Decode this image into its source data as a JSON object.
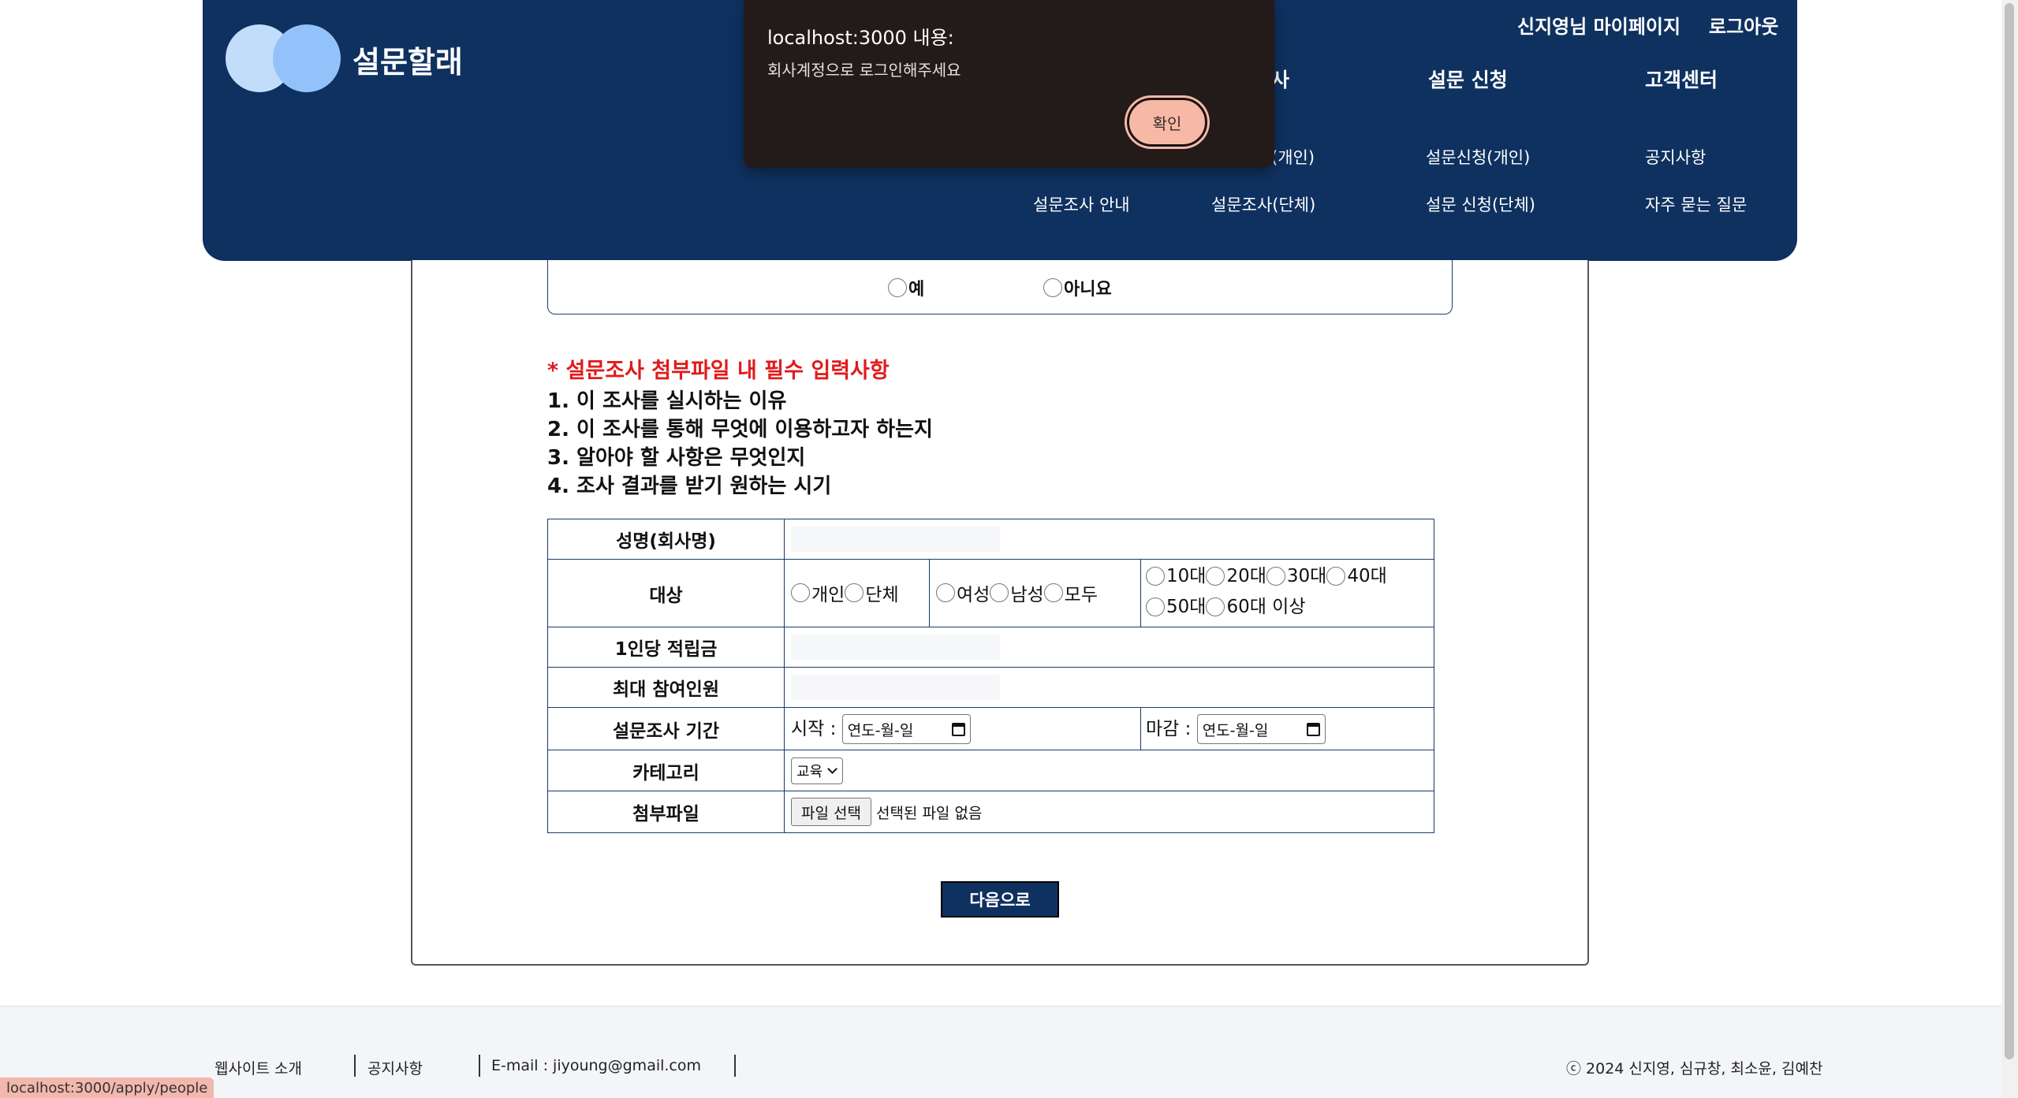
{
  "header": {
    "brand": "설문할래",
    "mypage_label": "신지영님 마이페이지",
    "logout_label": "로그아웃",
    "menu": {
      "survey_top": "사",
      "apply_top": "설문 신청",
      "support_top": "고객센터",
      "survey_guide": "설문조사 안내",
      "survey_personal": "(개인)",
      "survey_group": "설문조사(단체)",
      "apply_personal": "설문신청(개인)",
      "apply_group": "설문 신청(단체)",
      "notice": "공지사항",
      "faq": "자주 묻는 질문"
    }
  },
  "dialog": {
    "title": "localhost:3000 내용:",
    "message": "회사계정으로 로그인해주세요",
    "confirm_label": "확인"
  },
  "question": {
    "yes_label": "예",
    "no_label": "아니요"
  },
  "notice": {
    "title": "* 설문조사 첨부파일 내 필수 입력사항",
    "items": [
      "1. 이 조사를 실시하는 이유",
      "2. 이 조사를 통해 무엇에 이용하고자 하는지",
      "3. 알아야 할 사항은 무엇인지",
      "4. 조사 결과를 받기 원하는 시기"
    ]
  },
  "form": {
    "name_label": "성명(회사명)",
    "target_label": "대상",
    "target_type": [
      "개인",
      "단체"
    ],
    "gender": [
      "여성",
      "남성",
      "모두"
    ],
    "ages_row1": [
      "10대",
      "20대",
      "30대",
      "40대"
    ],
    "ages_row2": [
      "50대",
      "60대 이상"
    ],
    "reward_label": "1인당 적립금",
    "max_label": "최대 참여인원",
    "period_label": "설문조사 기간",
    "start_label": "시작 :",
    "end_label": "마감 :",
    "date_placeholder": "연도-월-일",
    "category_label": "카테고리",
    "category_value": "교육",
    "file_label": "첨부파일",
    "file_button": "파일 선택",
    "file_none": "선택된 파일 없음",
    "next_label": "다음으로"
  },
  "footer": {
    "about": "웹사이트 소개",
    "notice": "공지사항",
    "email": "E-mail : jiyoung@gmail.com",
    "copyright": "ⓒ 2024 신지영, 심규창, 최소윤, 김예찬"
  },
  "status_url": "localhost:3000/apply/people",
  "colors": {
    "header_bg": "#0f3160",
    "dialog_bg": "#231a1a",
    "confirm_btn": "#f7b9a6",
    "notice_red": "#e01b1b",
    "logo_light": "#c2dcfb",
    "logo_mid": "#93c2fb"
  }
}
